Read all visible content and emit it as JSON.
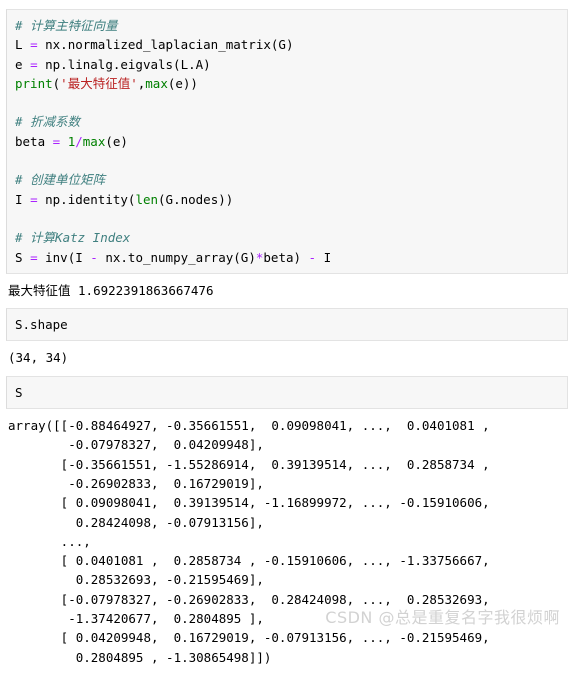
{
  "notebook": {
    "cells": [
      {
        "type": "input",
        "name": "code-cell-katz",
        "lines": [
          [
            {
              "t": "# 计算主特征向量",
              "c": "tok-comment"
            }
          ],
          [
            {
              "t": "L ",
              "c": "tok-name"
            },
            {
              "t": "=",
              "c": "tok-op"
            },
            {
              "t": " nx.normalized_laplacian_matrix(G)",
              "c": "tok-name"
            }
          ],
          [
            {
              "t": "e ",
              "c": "tok-name"
            },
            {
              "t": "=",
              "c": "tok-op"
            },
            {
              "t": " np.linalg.eigvals(L.A)",
              "c": "tok-name"
            }
          ],
          [
            {
              "t": "print",
              "c": "tok-print"
            },
            {
              "t": "(",
              "c": "tok-name"
            },
            {
              "t": "'最大特征值'",
              "c": "tok-str"
            },
            {
              "t": ",",
              "c": "tok-name"
            },
            {
              "t": "max",
              "c": "tok-builtin"
            },
            {
              "t": "(e))",
              "c": "tok-name"
            }
          ],
          [
            {
              "t": "",
              "c": "tok-name"
            }
          ],
          [
            {
              "t": "# 折减系数",
              "c": "tok-comment"
            }
          ],
          [
            {
              "t": "beta ",
              "c": "tok-name"
            },
            {
              "t": "=",
              "c": "tok-op"
            },
            {
              "t": " ",
              "c": "tok-name"
            },
            {
              "t": "1",
              "c": "tok-num"
            },
            {
              "t": "/",
              "c": "tok-op"
            },
            {
              "t": "max",
              "c": "tok-builtin"
            },
            {
              "t": "(e)",
              "c": "tok-name"
            }
          ],
          [
            {
              "t": "",
              "c": "tok-name"
            }
          ],
          [
            {
              "t": "# 创建单位矩阵",
              "c": "tok-comment"
            }
          ],
          [
            {
              "t": "I ",
              "c": "tok-name"
            },
            {
              "t": "=",
              "c": "tok-op"
            },
            {
              "t": " np.identity(",
              "c": "tok-name"
            },
            {
              "t": "len",
              "c": "tok-builtin"
            },
            {
              "t": "(G.nodes))",
              "c": "tok-name"
            }
          ],
          [
            {
              "t": "",
              "c": "tok-name"
            }
          ],
          [
            {
              "t": "# 计算Katz Index",
              "c": "tok-comment"
            }
          ],
          [
            {
              "t": "S ",
              "c": "tok-name"
            },
            {
              "t": "=",
              "c": "tok-op"
            },
            {
              "t": " inv(I ",
              "c": "tok-name"
            },
            {
              "t": "-",
              "c": "tok-op"
            },
            {
              "t": " nx.to_numpy_array(G)",
              "c": "tok-name"
            },
            {
              "t": "*",
              "c": "tok-op"
            },
            {
              "t": "beta) ",
              "c": "tok-name"
            },
            {
              "t": "-",
              "c": "tok-op"
            },
            {
              "t": " I",
              "c": "tok-name"
            }
          ]
        ]
      },
      {
        "type": "output",
        "name": "stdout-eigenvalue",
        "text": "最大特征值 1.6922391863667476"
      },
      {
        "type": "input",
        "name": "code-cell-shape",
        "lines": [
          [
            {
              "t": "S.shape",
              "c": "tok-name"
            }
          ]
        ]
      },
      {
        "type": "output",
        "name": "result-shape",
        "text": "(34, 34)"
      },
      {
        "type": "input",
        "name": "code-cell-s",
        "lines": [
          [
            {
              "t": "S",
              "c": "tok-name"
            }
          ]
        ]
      },
      {
        "type": "output",
        "name": "result-array",
        "text": "array([[-0.88464927, -0.35661551,  0.09098041, ...,  0.0401081 ,\n        -0.07978327,  0.04209948],\n       [-0.35661551, -1.55286914,  0.39139514, ...,  0.2858734 ,\n        -0.26902833,  0.16729019],\n       [ 0.09098041,  0.39139514, -1.16899972, ..., -0.15910606,\n         0.28424098, -0.07913156],\n       ...,\n       [ 0.0401081 ,  0.2858734 , -0.15910606, ..., -1.33756667,\n         0.28532693, -0.21595469],\n       [-0.07978327, -0.26902833,  0.28424098, ...,  0.28532693,\n        -1.37420677,  0.2804895 ],\n       [ 0.04209948,  0.16729019, -0.07913156, ..., -0.21595469,\n         0.2804895 , -1.30865498]])"
      }
    ]
  },
  "watermark": {
    "text": "CSDN @总是重复名字我很烦啊"
  },
  "colors": {
    "cell_background": "#f7f7f7",
    "cell_border": "#e3e3e3",
    "comment": "#408080",
    "operator": "#aa22ff",
    "builtin": "#008000",
    "string": "#ba2121",
    "number": "#008000",
    "text": "#000000",
    "watermark": "#d2d2d2"
  }
}
